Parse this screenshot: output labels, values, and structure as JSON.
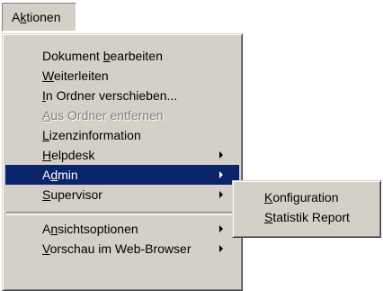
{
  "menubar": {
    "title": "Aktionen",
    "title_ul_index": 1
  },
  "menu": {
    "items": [
      {
        "label": "Dokument bearbeiten",
        "ul_index": 9,
        "enabled": true,
        "submenu": false
      },
      {
        "label": "Weiterleiten",
        "ul_index": 0,
        "enabled": true,
        "submenu": false
      },
      {
        "label": "In Ordner verschieben...",
        "ul_index": 0,
        "enabled": true,
        "submenu": false
      },
      {
        "label": "Aus Ordner entfernen",
        "ul_index": 0,
        "enabled": false,
        "submenu": false
      },
      {
        "label": "Lizenzinformation",
        "ul_index": 0,
        "enabled": true,
        "submenu": false
      },
      {
        "label": "Helpdesk",
        "ul_index": 0,
        "enabled": true,
        "submenu": true
      },
      {
        "label": "Admin",
        "ul_index": 1,
        "enabled": true,
        "submenu": true,
        "active": true
      },
      {
        "label": "Supervisor",
        "ul_index": 0,
        "enabled": true,
        "submenu": true
      }
    ],
    "items2": [
      {
        "label": "Ansichtsoptionen",
        "ul_index": 1,
        "enabled": true,
        "submenu": true
      },
      {
        "label": "Vorschau im Web-Browser",
        "ul_index": 0,
        "enabled": true,
        "submenu": true
      }
    ]
  },
  "submenu": {
    "items": [
      {
        "label": "Konfiguration",
        "ul_index": 0
      },
      {
        "label": "Statistik Report",
        "ul_index": 0
      }
    ]
  },
  "colors": {
    "menu_bg": "#d4d0c8",
    "highlight": "#0a246a",
    "disabled": "#808080"
  }
}
